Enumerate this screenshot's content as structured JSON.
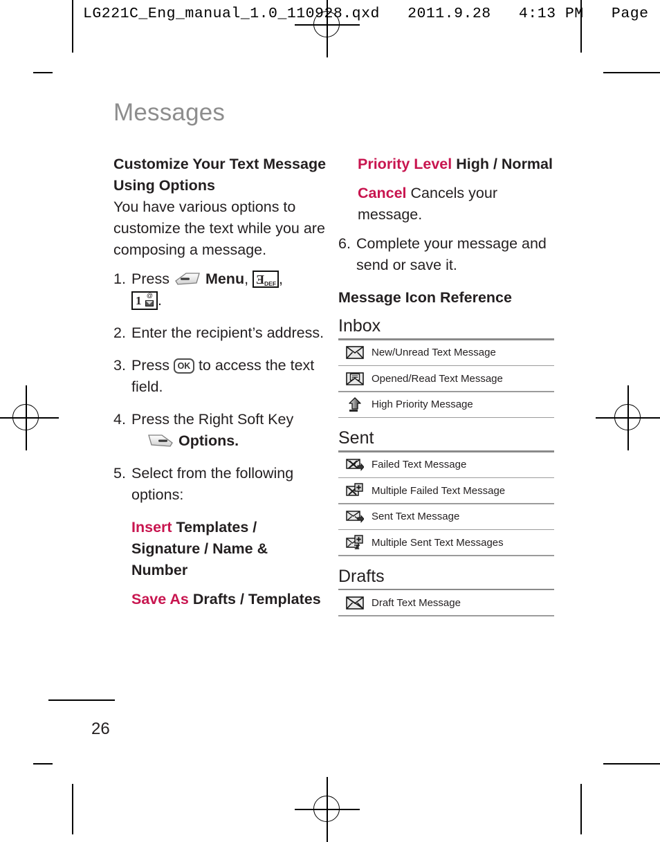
{
  "print_header": {
    "text": "LG221C_Eng_manual_1.0_110928.qxd   2011.9.28   4:13 PM   Page"
  },
  "chapter": {
    "title": "Messages"
  },
  "page_number": "26",
  "colors": {
    "accent": "#c8154f",
    "chapter_title": "#8d8d8d",
    "rule": "#8a8a8a"
  },
  "left_column": {
    "heading": "Customize Your Text Message Using Options",
    "intro": "You have various options to customize the text while you are composing a message.",
    "steps": [
      {
        "num": "1.",
        "before": "Press",
        "key_menu_label": "Menu",
        "after": ",",
        "keys": [
          "3 DEF",
          "1 @"
        ]
      },
      {
        "num": "2.",
        "text": "Enter the recipient’s address."
      },
      {
        "num": "3.",
        "before": "Press",
        "key": "OK",
        "after": "to access the text field."
      },
      {
        "num": "4.",
        "text": "Press the Right Soft Key",
        "sub_label": "Options."
      },
      {
        "num": "5.",
        "text": "Select from the following options:"
      }
    ],
    "options": [
      {
        "label": "Insert",
        "value": "Templates / Signature / Name & Number"
      },
      {
        "label": "Save As",
        "value": "Drafts / Templates"
      }
    ]
  },
  "right_column": {
    "options": [
      {
        "label": "Priority Level",
        "value": "High / Normal"
      },
      {
        "label": "Cancel",
        "value": "Cancels your message."
      }
    ],
    "step6": {
      "num": "6.",
      "text": "Complete your message and send or save it."
    },
    "icon_reference": {
      "heading": "Message Icon Reference",
      "groups": [
        {
          "title": "Inbox",
          "rows": [
            {
              "icon": "envelope-closed-icon",
              "label": "New/Unread Text Message"
            },
            {
              "icon": "envelope-open-read-icon",
              "label": "Opened/Read Text Message"
            },
            {
              "icon": "up-arrow-priority-icon",
              "label": "High Priority Message"
            }
          ]
        },
        {
          "title": "Sent",
          "rows": [
            {
              "icon": "envelope-failed-icon",
              "label": "Failed Text Message"
            },
            {
              "icon": "envelope-multiple-failed-icon",
              "label": "Multiple Failed Text Message"
            },
            {
              "icon": "envelope-sent-icon",
              "label": "Sent Text Message"
            },
            {
              "icon": "envelope-multiple-sent-icon",
              "label": "Multiple Sent Text Messages"
            }
          ]
        },
        {
          "title": "Drafts",
          "rows": [
            {
              "icon": "envelope-draft-icon",
              "label": "Draft Text Message"
            }
          ]
        }
      ]
    }
  }
}
